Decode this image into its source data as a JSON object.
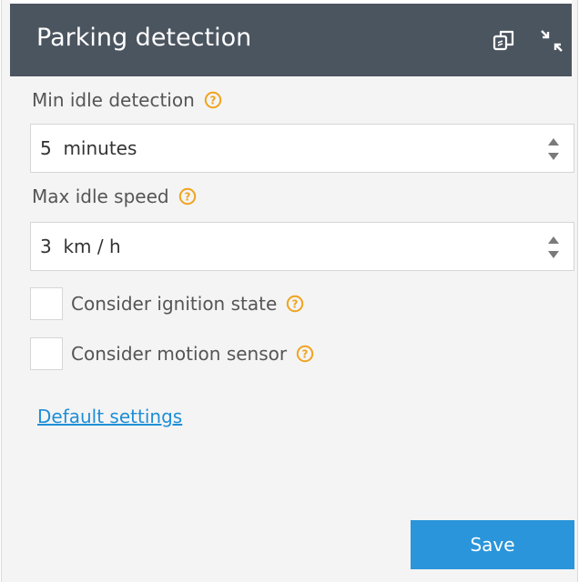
{
  "header": {
    "title": "Parking detection",
    "icons": [
      "copy-icon",
      "collapse-icon"
    ]
  },
  "fields": {
    "min_idle": {
      "label": "Min idle detection",
      "value": "5  minutes",
      "help_icon": "help-icon"
    },
    "max_speed": {
      "label": "Max idle speed",
      "value": "3  km / h",
      "help_icon": "help-icon"
    }
  },
  "checkboxes": {
    "ignition": {
      "label": "Consider ignition state",
      "checked": false
    },
    "motion": {
      "label": "Consider motion sensor",
      "checked": false
    }
  },
  "link": {
    "label": "Default settings"
  },
  "actions": {
    "save_label": "Save"
  },
  "colors": {
    "header_bg": "#4b5560",
    "panel_bg": "#f4f4f4",
    "accent": "#2a95da",
    "link": "#1e8fd6",
    "help": "#f0a31e"
  }
}
